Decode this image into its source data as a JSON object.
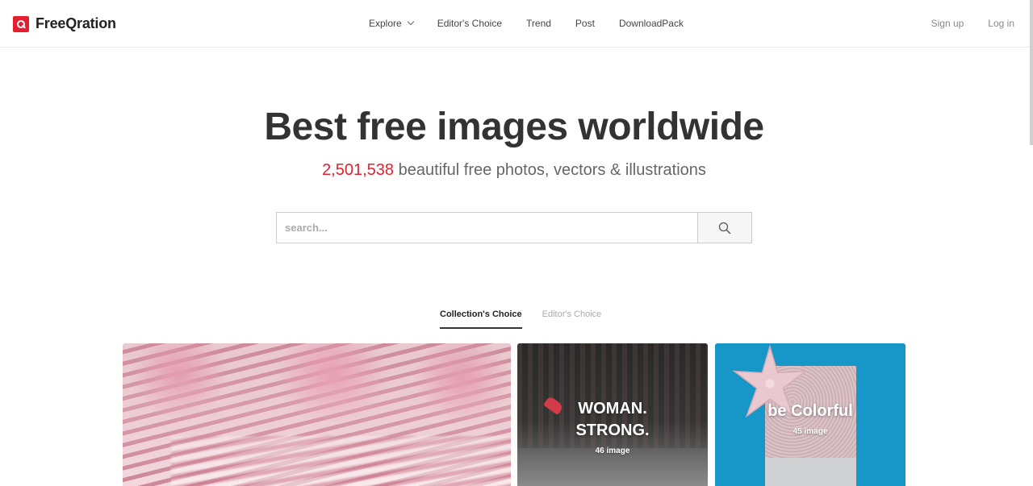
{
  "brand": {
    "name": "FreeQration",
    "logo_color": "#e5202e"
  },
  "nav": [
    {
      "label": "Explore",
      "has_dropdown": true
    },
    {
      "label": "Editor's Choice"
    },
    {
      "label": "Trend"
    },
    {
      "label": "Post"
    },
    {
      "label": "DownloadPack"
    }
  ],
  "auth": {
    "signup": "Sign up",
    "login": "Log in"
  },
  "hero": {
    "title": "Best free images worldwide",
    "count": "2,501,538",
    "subtitle": " beautiful free photos, vectors & illustrations"
  },
  "search": {
    "placeholder": "search...",
    "value": "",
    "button_icon": "search-icon"
  },
  "tabs": [
    {
      "label": "Collection's Choice",
      "active": true
    },
    {
      "label": "Editor's Choice",
      "active": false
    }
  ],
  "collections": [
    {
      "title": "",
      "count": ""
    },
    {
      "title": "WOMAN.\nSTRONG.",
      "count": "46 image"
    },
    {
      "title": "be Colorful",
      "count": "45 image"
    }
  ],
  "colors": {
    "accent": "#e5202e",
    "text": "#333333",
    "muted": "#888888"
  }
}
